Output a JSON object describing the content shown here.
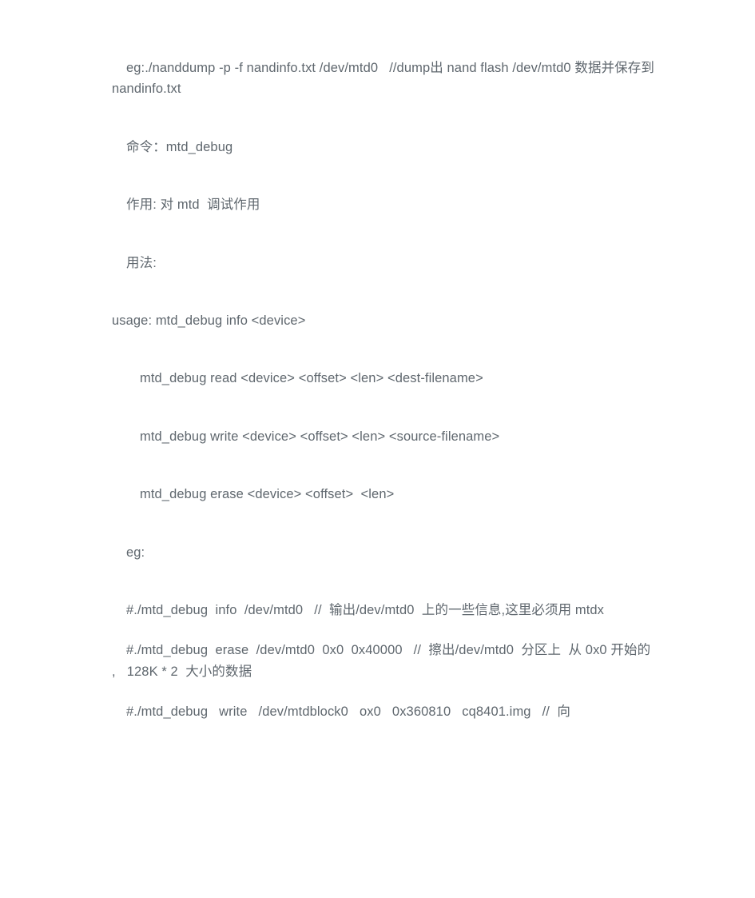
{
  "document": {
    "type": "text-document",
    "language": "zh-CN",
    "background_color": "#ffffff",
    "text_color": "#5f676e",
    "paragraphs": [
      {
        "id": "p-nanddump-example",
        "indent": "indent-1",
        "text": "eg:./nanddump -p -f nandinfo.txt /dev/mtd0   //dump出 nand flash /dev/mtd0 数据并保存到 nandinfo.txt"
      },
      {
        "id": "p-command-title",
        "indent": "indent-1",
        "text": "命令：mtd_debug"
      },
      {
        "id": "p-purpose",
        "indent": "indent-1",
        "text": "作用: 对 mtd  调试作用"
      },
      {
        "id": "p-usage-title",
        "indent": "indent-1",
        "text": "用法:"
      },
      {
        "id": "p-usage-info",
        "indent": "indent-0",
        "text": "usage: mtd_debug info <device>"
      },
      {
        "id": "p-usage-read",
        "indent": "indent-2",
        "text": "mtd_debug read <device> <offset> <len> <dest-filename>"
      },
      {
        "id": "p-usage-write",
        "indent": "indent-2",
        "text": "mtd_debug write <device> <offset> <len> <source-filename>"
      },
      {
        "id": "p-usage-erase",
        "indent": "indent-2",
        "text": "mtd_debug erase <device> <offset>  <len>"
      },
      {
        "id": "p-eg-label",
        "indent": "indent-1",
        "text": "eg:"
      },
      {
        "id": "p-eg-info",
        "indent": "indent-1",
        "text": "#./mtd_debug  info  /dev/mtd0   //  输出/dev/mtd0  上的一些信息,这里必须用 mtdx"
      },
      {
        "id": "p-eg-erase",
        "indent": "indent-1",
        "text": "#./mtd_debug  erase  /dev/mtd0  0x0  0x40000   //  擦出/dev/mtd0  分区上  从 0x0 开始的   ,   128K * 2  大小的数据"
      },
      {
        "id": "p-eg-write",
        "indent": "indent-1",
        "text": "#./mtd_debug   write   /dev/mtdblock0   ox0   0x360810   cq8401.img   //  向"
      }
    ]
  }
}
